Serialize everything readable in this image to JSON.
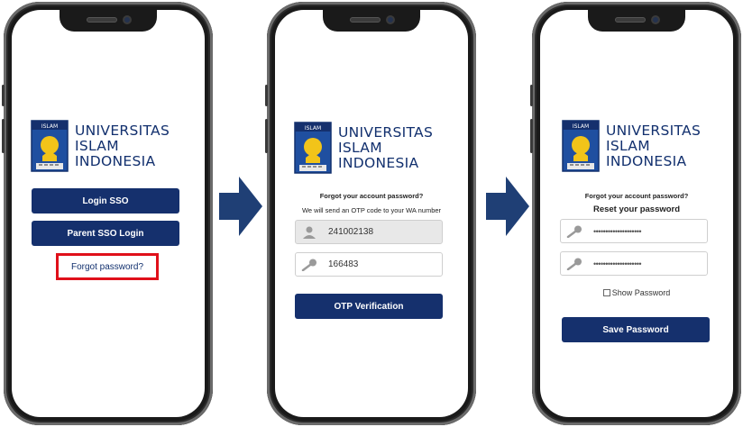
{
  "university": {
    "line1": "UNIVERSITAS",
    "line2": "ISLAM",
    "line3": "INDONESIA",
    "crest_label": "ISLAM",
    "crest_side_left": "UNIVERSITAS",
    "crest_side_right": "INDONESIA"
  },
  "screen1": {
    "login_sso": "Login SSO",
    "parent_sso": "Parent SSO Login",
    "forgot": "Forgot password?"
  },
  "screen2": {
    "heading": "Forgot your account password?",
    "subheading": "We will send an OTP code to your WA number",
    "user_value": "241002138",
    "otp_value": "166483",
    "submit": "OTP Verification"
  },
  "screen3": {
    "heading": "Forgot your account password?",
    "title": "Reset your password",
    "password_mask": "••••••••••••••••••••",
    "confirm_mask": "••••••••••••••••••••",
    "show_password": "Show Password",
    "submit": "Save Password"
  },
  "colors": {
    "primary": "#15306d",
    "highlight": "#e0101a",
    "arrow": "#1f3f75"
  },
  "icons": [
    "user-icon",
    "key-icon",
    "arrow-right-icon",
    "university-crest-icon"
  ]
}
